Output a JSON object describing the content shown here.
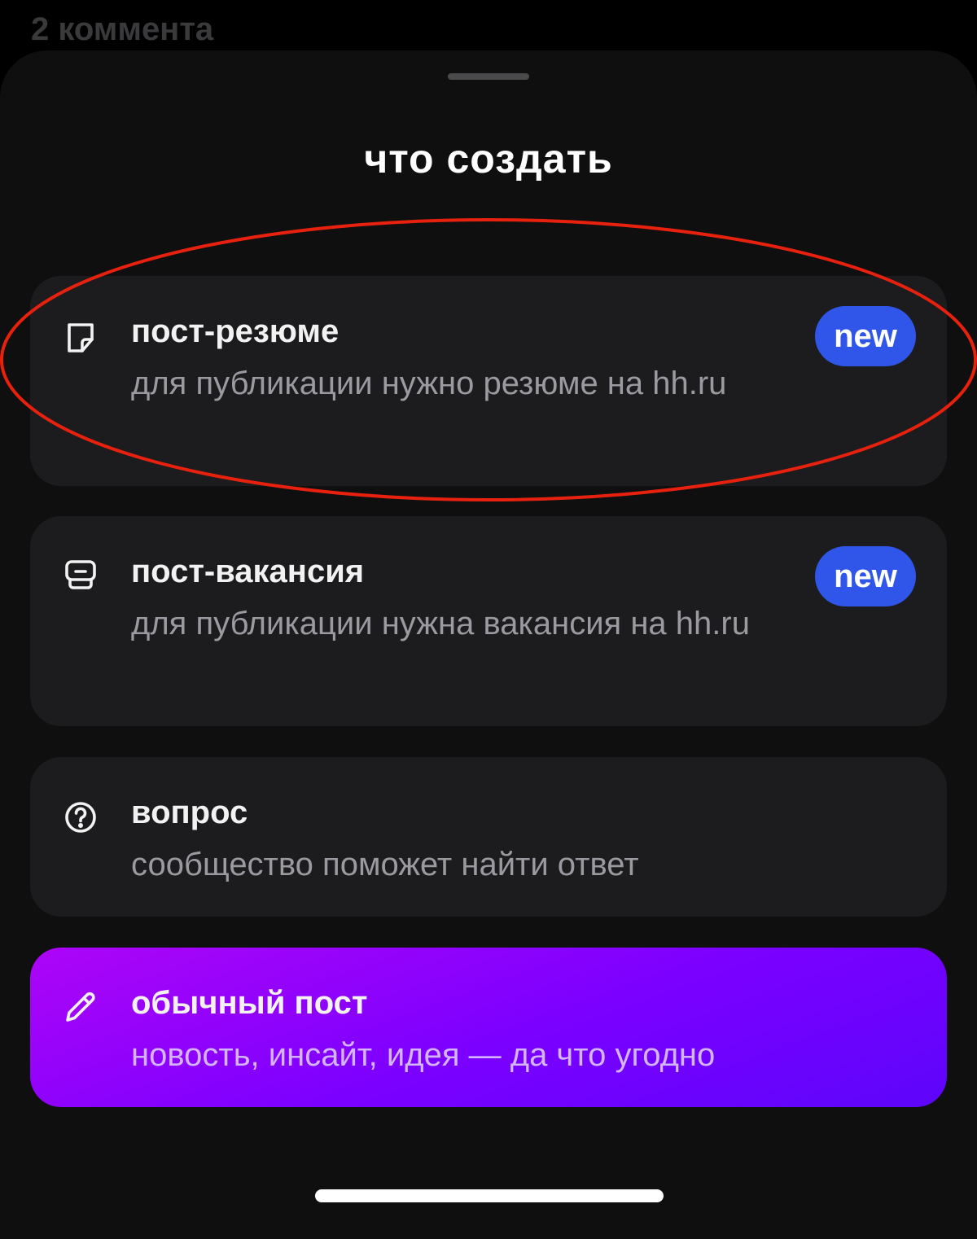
{
  "background_text": "2 коммента",
  "sheet": {
    "title": "что создать"
  },
  "options": [
    {
      "title": "пост-резюме",
      "subtitle": "для публикации нужно резюме на hh.ru",
      "badge": "new",
      "icon": "sticky-note-icon"
    },
    {
      "title": "пост-вакансия",
      "subtitle": "для публикации нужна вакансия на hh.ru",
      "badge": "new",
      "icon": "briefcase-icon"
    },
    {
      "title": "вопрос",
      "subtitle": "сообщество поможет найти ответ",
      "icon": "question-circle-icon"
    },
    {
      "title": "обычный пост",
      "subtitle": "новость, инсайт, идея — да что угодно",
      "icon": "pencil-icon"
    }
  ],
  "colors": {
    "badge": "#2f56e9",
    "card": "#1c1c1e",
    "sheet": "#0f0f10",
    "primary_gradient_start": "#ad05f7",
    "primary_gradient_end": "#5d05fb",
    "annotation_ring": "#e8210f"
  }
}
